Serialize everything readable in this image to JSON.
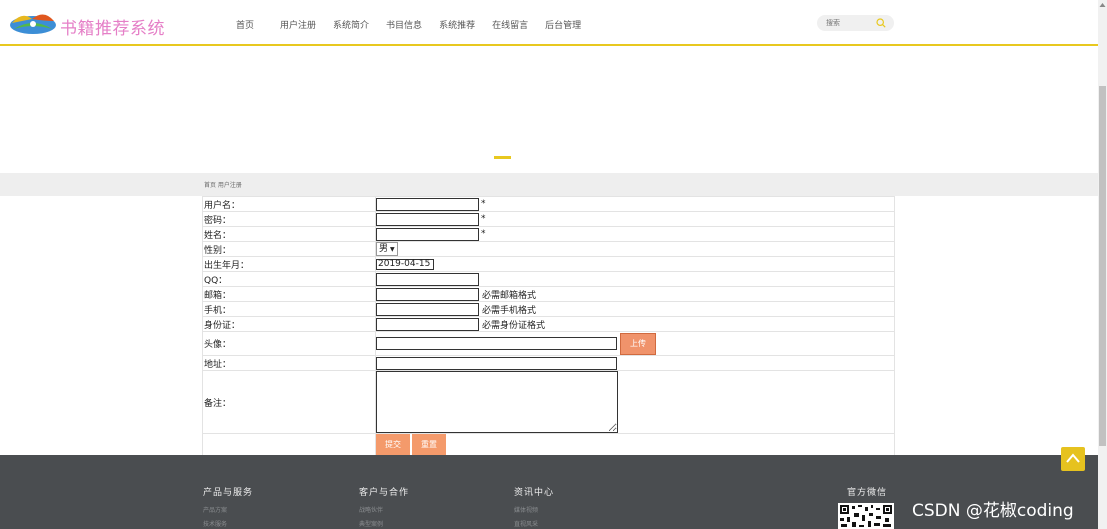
{
  "header": {
    "logo_text": "书籍推荐系统",
    "nav": [
      "首页",
      "用户注册",
      "系统简介",
      "书目信息",
      "系统推荐",
      "在线留言",
      "后台管理"
    ],
    "search_placeholder": "搜索"
  },
  "breadcrumb": "首页 用户注册",
  "form": {
    "username_label": "用户名：",
    "password_label": "密码：",
    "name_label": "姓名：",
    "gender_label": "性别：",
    "gender_value": "男",
    "birth_label": "出生年月：",
    "birth_value": "2019-04-15",
    "qq_label": "QQ：",
    "email_label": "邮箱：",
    "email_hint": "必需邮箱格式",
    "phone_label": "手机：",
    "phone_hint": "必需手机格式",
    "idcard_label": "身份证：",
    "idcard_hint": "必需身份证格式",
    "avatar_label": "头像：",
    "upload_label": "上传",
    "address_label": "地址：",
    "note_label": "备注：",
    "required_mark": "*",
    "submit_label": "提交",
    "reset_label": "重置"
  },
  "footer": {
    "col1_title": "产品与服务",
    "col1_links": [
      "产品方案",
      "技术服务"
    ],
    "col2_title": "客户与合作",
    "col2_links": [
      "战略伙伴",
      "典型案例"
    ],
    "col3_title": "资讯中心",
    "col3_links": [
      "媒体视频",
      "直视风采"
    ],
    "col4_title": "官方微信"
  },
  "watermark": "CSDN @花椒coding",
  "colors": {
    "accent": "#e8c81f",
    "logo_text": "#e57fc7",
    "button": "#f49a6b",
    "footer_bg": "#4a4d50"
  }
}
